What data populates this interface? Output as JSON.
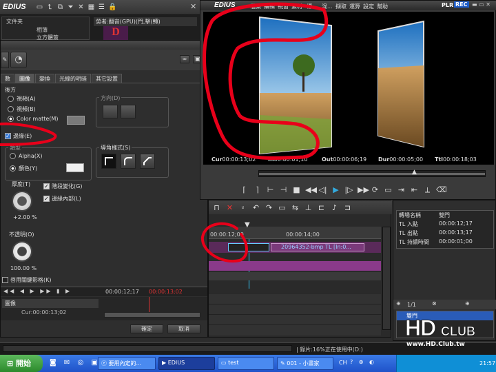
{
  "app": {
    "logo": "EDIUS"
  },
  "left_toolbar": {
    "icons": [
      "folder-icon",
      "up-icon",
      "open-icon",
      "settings-icon",
      "cut-icon",
      "grid-icon",
      "list-icon",
      "lock-icon"
    ]
  },
  "bin": {
    "folders": [
      "文件夹",
      "相簿",
      "立方體簽"
    ],
    "clip_label": "勞者:翻音(GPU)(門,擊(轉)"
  },
  "panel": {
    "tabs": [
      "數",
      "圖像",
      "變換",
      "光線的明暗",
      "其它設置"
    ],
    "back_section": "後方",
    "radio_video_a": "視頻(A)",
    "radio_video_b": "視頻(B)",
    "radio_color_matte": "Color matte(M)",
    "direction_label": "方向(D)",
    "edge_checkbox": "邊緣(E)",
    "edge_type_title": "類型",
    "alpha_radio": "Alpha(X)",
    "color_radio": "顏色(Y)",
    "corner_title": "導角樣式(S)",
    "thickness_label": "厚度(T)",
    "thickness_value": "+2.00 %",
    "gradient_checkbox": "階段變化(G)",
    "inner_edge_checkbox": "邊緣內部(L)",
    "opacity_label": "不透明(O)",
    "opacity_value": "100.00 %",
    "keyframe_checkbox": "啓用關鍵影格(K)",
    "tc_a": "00:00:12;17",
    "tc_b": "00:00:13;02",
    "track_label": "圖像",
    "cur_label": "Cur:",
    "cur_value": "00:00:13;02",
    "ok_button": "確定",
    "cancel_button": "取消"
  },
  "player": {
    "brand": "EDIUS",
    "menu": [
      "檔案",
      "編輯",
      "視窗",
      "素材",
      "標...",
      "混...",
      "擷取",
      "運算",
      "設定",
      "幫助"
    ],
    "mode_plr": "PLR",
    "mode_rec": "REC",
    "timecodes": [
      {
        "label": "Cur",
        "value": "00:00:13;02"
      },
      {
        "label": "In",
        "value": "00:00:01;10"
      },
      {
        "label": "Out",
        "value": "00:00:06;19"
      },
      {
        "label": "Dur",
        "value": "00:00:05;00"
      },
      {
        "label": "Ttl",
        "value": "00:00:18;03"
      }
    ]
  },
  "timeline": {
    "ruler_a": "00:00:12;00",
    "ruler_b": "00:00:14;00",
    "clip_label": "20964352-bmp  TL [In:0..."
  },
  "info_panel": {
    "rows": [
      {
        "k": "轉場名稱",
        "v": "雙門"
      },
      {
        "k": "TL 入點",
        "v": "00:00:12;17"
      },
      {
        "k": "TL 出點",
        "v": "00:00:13;17"
      },
      {
        "k": "TL 持續時間",
        "v": "00:00:01;00"
      }
    ],
    "page": "1/1",
    "item": "雙門"
  },
  "status": {
    "text": "| 錄片:16%正在使用中(D:)"
  },
  "watermark": {
    "text": "HD CLUB",
    "url": "www.HD.Club.tw"
  },
  "taskbar": {
    "start": "開始",
    "items": [
      "要用內定的...",
      "EDIUS",
      "test",
      "001 - 小畫家"
    ],
    "lang": "CH",
    "clock": "21:57"
  },
  "colors": {
    "annotation": "#e8001a",
    "taskbar": "#245edb",
    "start": "#3c9b3c"
  }
}
